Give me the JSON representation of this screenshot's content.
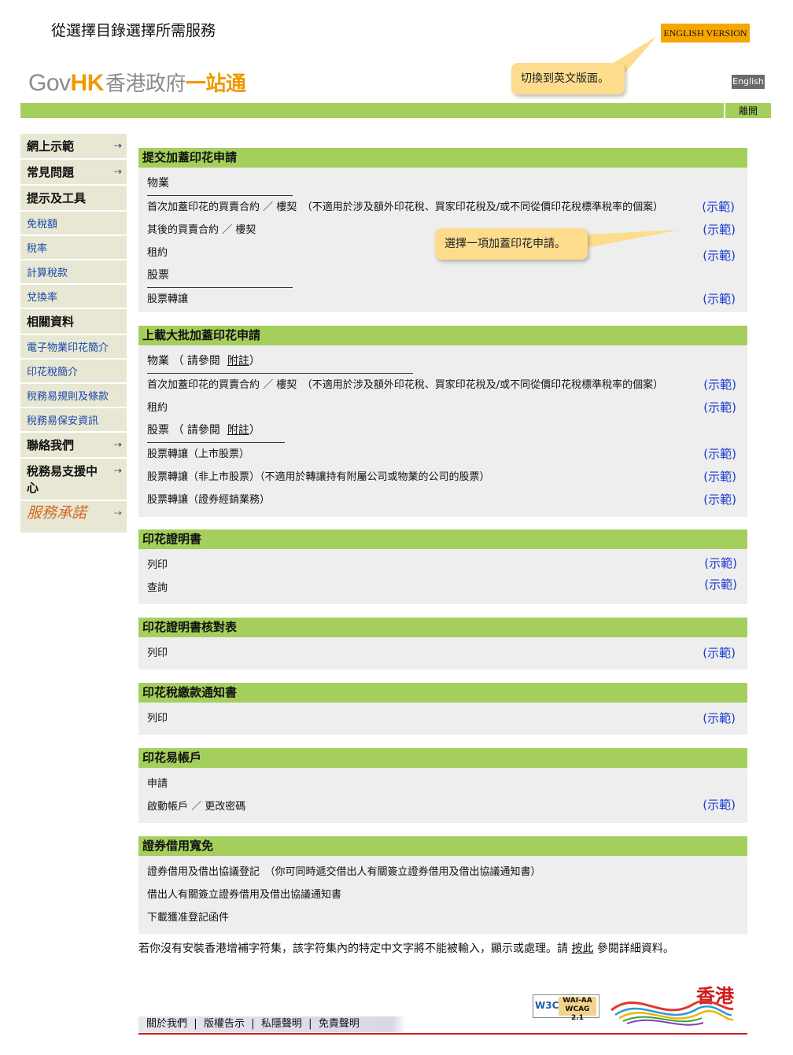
{
  "header": {
    "top_title": "從選擇目錄選擇所需服務",
    "english_version_btn": "ENGLISH VERSION",
    "logo": {
      "gov": "Gov",
      "hk": "HK",
      "zh1": "香港政府",
      "zh2": "一站通"
    },
    "callout_english": "切換到英文版面。",
    "english_link": "English",
    "exit": "離開"
  },
  "sidebar": [
    {
      "type": "head",
      "label": "網上示範",
      "arrow": true
    },
    {
      "type": "head",
      "label": "常見問題",
      "arrow": true
    },
    {
      "type": "head",
      "label": "提示及工具",
      "arrow": false
    },
    {
      "type": "link",
      "label": "免稅額"
    },
    {
      "type": "link",
      "label": "稅率"
    },
    {
      "type": "link",
      "label": "計算稅款"
    },
    {
      "type": "link",
      "label": "兌換率"
    },
    {
      "type": "head",
      "label": "相關資料",
      "arrow": false
    },
    {
      "type": "link",
      "label": "電子物業印花簡介"
    },
    {
      "type": "link",
      "label": "印花稅簡介"
    },
    {
      "type": "link",
      "label": "稅務易規則及條款"
    },
    {
      "type": "link",
      "label": "稅務易保安資訊"
    },
    {
      "type": "head",
      "label": "聯絡我們",
      "arrow": true
    },
    {
      "type": "head",
      "label": "稅務易支援中心",
      "arrow": true
    },
    {
      "type": "brand",
      "label": "服務承諾",
      "arrow": true
    }
  ],
  "example_label": "(示範)",
  "callout_select": "選擇一項加蓋印花申請。",
  "sections": {
    "s1": {
      "title": "提交加蓋印花申請",
      "sub_property": "物業",
      "r1": "首次加蓋印花的買賣合約 ／ 樓契　（不適用於涉及額外印花稅、買家印花稅及/或不同從價印花稅標準稅率的個案）",
      "r2": "其後的買賣合約 ／ 樓契",
      "r3": "租約",
      "sub_stock": "股票",
      "r4": "股票轉讓"
    },
    "s2": {
      "title": "上載大批加蓋印花申請",
      "sub_property": "物業 （ 請參閱",
      "note_link": "附註",
      "close_paren": "）",
      "r1": "首次加蓋印花的買賣合約 ／ 樓契　（不適用於涉及額外印花稅、買家印花稅及/或不同從價印花稅標準稅率的個案）",
      "r2": "租約",
      "sub_stock": "股票 （ 請參閱",
      "r3": "股票轉讓（上市股票）",
      "r4": "股票轉讓（非上市股票）（不適用於轉讓持有附屬公司或物業的公司的股票）",
      "r5": "股票轉讓（證券經銷業務）"
    },
    "s3": {
      "title": "印花證明書",
      "r1": "列印",
      "r2": "查詢"
    },
    "s4": {
      "title": "印花證明書核對表",
      "r1": "列印"
    },
    "s5": {
      "title": "印花稅繳款通知書",
      "r1": "列印"
    },
    "s6": {
      "title": "印花易帳戶",
      "r1": "申請",
      "r2": "啟動帳戶 ／ 更改密碼"
    },
    "s7": {
      "title": "證券借用寬免",
      "r1": "證券借用及借出協議登記　（你可同時遞交借出人有關簽立證券借用及借出協議通知書）",
      "r2": "借出人有關簽立證券借用及借出協議通知書",
      "r3": "下載獲准登記函件"
    }
  },
  "note": {
    "before": "若你沒有安裝香港增補字符集，該字符集內的特定中文字將不能被輸入，顯示或處理。請",
    "link": "按此",
    "after": " 參閱詳細資料。"
  },
  "footer": {
    "about": "關於我們",
    "copyright": "版權告示",
    "privacy": "私隱聲明",
    "disclaimer": "免責聲明",
    "sep": "|"
  },
  "badges": {
    "w3c": "W3C",
    "wai": "WAI-AA",
    "wcag": "WCAG 2.1",
    "hk": "香港"
  },
  "colors": {
    "green": "#a5cf5c",
    "orange": "#f7a600",
    "callout": "#fddc8d",
    "link_blue": "#1a48a8",
    "example_blue": "#1a3ad0",
    "footer_red": "#d01a1a"
  }
}
